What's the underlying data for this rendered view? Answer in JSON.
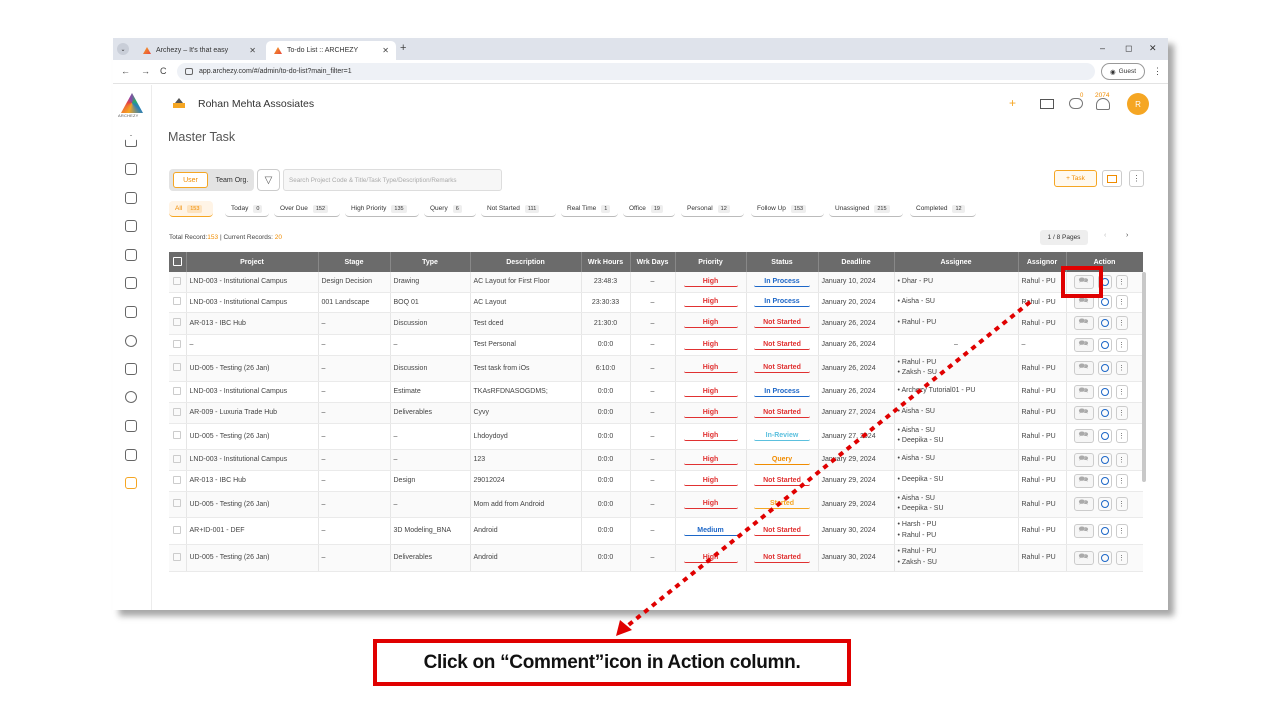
{
  "browser": {
    "tabs": [
      {
        "label": "Archezy – It's that easy",
        "active": false
      },
      {
        "label": "To-do List :: ARCHEZY",
        "active": true
      }
    ],
    "new_tab": "+",
    "url": "app.archezy.com/#/admin/to-do-list?main_filter=1",
    "profile": "Guest",
    "window_controls": {
      "minimize": "–",
      "maximize": "◻",
      "close": "✕"
    }
  },
  "app": {
    "logo_text": "ARCHEZY",
    "company": "Rohan Mehta Assosiates",
    "page_title": "Master Task",
    "header": {
      "chat_badge": "0",
      "bell_badge": "2074",
      "avatar": "R"
    },
    "segments": {
      "user": "User",
      "team": "Team",
      "org": "Org."
    },
    "search_placeholder": "Search Project Code & Title/Task Type/Description/Remarks",
    "task_button": "+  Task",
    "filters": [
      {
        "label": "All",
        "count": "153",
        "active": true
      },
      {
        "label": "Today",
        "count": "0"
      },
      {
        "label": "Over Due",
        "count": "152"
      },
      {
        "label": "High Priority",
        "count": "135"
      },
      {
        "label": "Query",
        "count": "6"
      },
      {
        "label": "Not Started",
        "count": "111"
      },
      {
        "label": "Real Time",
        "count": "1"
      },
      {
        "label": "Office",
        "count": "19"
      },
      {
        "label": "Personal",
        "count": "12"
      },
      {
        "label": "Follow Up",
        "count": "153"
      },
      {
        "label": "Unassigned",
        "count": "215"
      },
      {
        "label": "Completed",
        "count": "12"
      }
    ],
    "records": {
      "total_label": "Total Record:",
      "total": "153",
      "sep": " | Current Records: ",
      "current": "20"
    },
    "pagination": {
      "label": "1 / 8 Pages",
      "prev": "‹",
      "next": "›"
    },
    "table": {
      "columns": [
        "Project",
        "Stage",
        "Type",
        "Description",
        "Wrk Hours",
        "Wrk Days",
        "Priority",
        "Status",
        "Deadline",
        "Assignee",
        "Assignor",
        "Action"
      ],
      "rows": [
        {
          "project": "LND-003 - Institutional Campus",
          "stage": "Design Decision",
          "type": "Drawing",
          "desc": "AC Layout for First Floor",
          "hours": "23:48:3",
          "days": "–",
          "priority": "High",
          "status": "In Process",
          "deadline": "January 10, 2024",
          "assignee": [
            "Dhar - PU"
          ],
          "assignor": "Rahul - PU"
        },
        {
          "project": "LND-003 - Institutional Campus",
          "stage": "001 Landscape",
          "type": "BOQ 01",
          "desc": "AC Layout",
          "hours": "23:30:33",
          "days": "–",
          "priority": "High",
          "status": "In Process",
          "deadline": "January 20, 2024",
          "assignee": [
            "Aisha - SU"
          ],
          "assignor": "Rahul - PU"
        },
        {
          "project": "AR-013 - IBC Hub",
          "stage": "–",
          "type": "Discussion",
          "desc": "Test dced",
          "hours": "21:30:0",
          "days": "–",
          "priority": "High",
          "status": "Not Started",
          "deadline": "January 26, 2024",
          "assignee": [
            "Rahul - PU"
          ],
          "assignor": "Rahul - PU"
        },
        {
          "project": "–",
          "stage": "–",
          "type": "–",
          "desc": "Test Personal",
          "hours": "0:0:0",
          "days": "–",
          "priority": "High",
          "status": "Not Started",
          "deadline": "January 26, 2024",
          "assignee_text": "–",
          "assignor": "–"
        },
        {
          "project": "UD-005 - Testing (26 Jan)",
          "stage": "–",
          "type": "Discussion",
          "desc": "Test task from iOs",
          "hours": "6:10:0",
          "days": "–",
          "priority": "High",
          "status": "Not Started",
          "deadline": "January 26, 2024",
          "assignee": [
            "Rahul - PU",
            "Zaksh - SU"
          ],
          "assignor": "Rahul - PU"
        },
        {
          "project": "LND-003 - Institutional Campus",
          "stage": "–",
          "type": "Estimate",
          "desc": "TKAsRFDNASOGDMS;",
          "hours": "0:0:0",
          "days": "–",
          "priority": "High",
          "status": "In Process",
          "deadline": "January 26, 2024",
          "assignee": [
            "Archezy Tutorial01 - PU"
          ],
          "assignor": "Rahul - PU"
        },
        {
          "project": "AR-009 - Luxuria Trade Hub",
          "stage": "–",
          "type": "Deliverables",
          "desc": "Cyvy",
          "hours": "0:0:0",
          "days": "–",
          "priority": "High",
          "status": "Not Started",
          "deadline": "January 27, 2024",
          "assignee": [
            "Aisha - SU"
          ],
          "assignor": "Rahul - PU"
        },
        {
          "project": "UD-005 - Testing (26 Jan)",
          "stage": "–",
          "type": "–",
          "desc": "Lhdoydoyd",
          "hours": "0:0:0",
          "days": "–",
          "priority": "High",
          "status": "In-Review",
          "deadline": "January 27, 2024",
          "assignee": [
            "Aisha - SU",
            "Deepika - SU"
          ],
          "assignor": "Rahul - PU"
        },
        {
          "project": "LND-003 - Institutional Campus",
          "stage": "–",
          "type": "–",
          "desc": "123",
          "hours": "0:0:0",
          "days": "–",
          "priority": "High",
          "status": "Query",
          "deadline": "January 29, 2024",
          "assignee": [
            "Aisha - SU"
          ],
          "assignor": "Rahul - PU"
        },
        {
          "project": "AR-013 - IBC Hub",
          "stage": "–",
          "type": "Design",
          "desc": "29012024",
          "hours": "0:0:0",
          "days": "–",
          "priority": "High",
          "status": "Not Started",
          "deadline": "January 29, 2024",
          "assignee": [
            "Deepika - SU"
          ],
          "assignor": "Rahul - PU"
        },
        {
          "project": "UD-005 - Testing (26 Jan)",
          "stage": "–",
          "type": "–",
          "desc": "Mom add from Android",
          "hours": "0:0:0",
          "days": "–",
          "priority": "High",
          "status": "Started",
          "deadline": "January 29, 2024",
          "assignee": [
            "Aisha - SU",
            "Deepika - SU"
          ],
          "assignor": "Rahul - PU"
        },
        {
          "project": "AR+ID-001 - DEF",
          "stage": "–",
          "type": "3D Modeling_BNA",
          "desc": "Android",
          "hours": "0:0:0",
          "days": "–",
          "priority": "Medium",
          "status": "Not Started",
          "deadline": "January 30, 2024",
          "assignee": [
            "Harsh - PU",
            "Rahul - PU"
          ],
          "assignor": "Rahul - PU"
        },
        {
          "project": "UD-005 - Testing (26 Jan)",
          "stage": "–",
          "type": "Deliverables",
          "desc": "Android",
          "hours": "0:0:0",
          "days": "–",
          "priority": "High",
          "status": "Not Started",
          "deadline": "January 30, 2024",
          "assignee": [
            "Rahul - PU",
            "Zaksh - SU"
          ],
          "assignor": "Rahul - PU"
        }
      ]
    }
  },
  "annotation": {
    "callout_prefix": "Click on ",
    "callout_bold": "“Comment”",
    "callout_suffix": " icon in Action column.",
    "color": "#e00000"
  }
}
